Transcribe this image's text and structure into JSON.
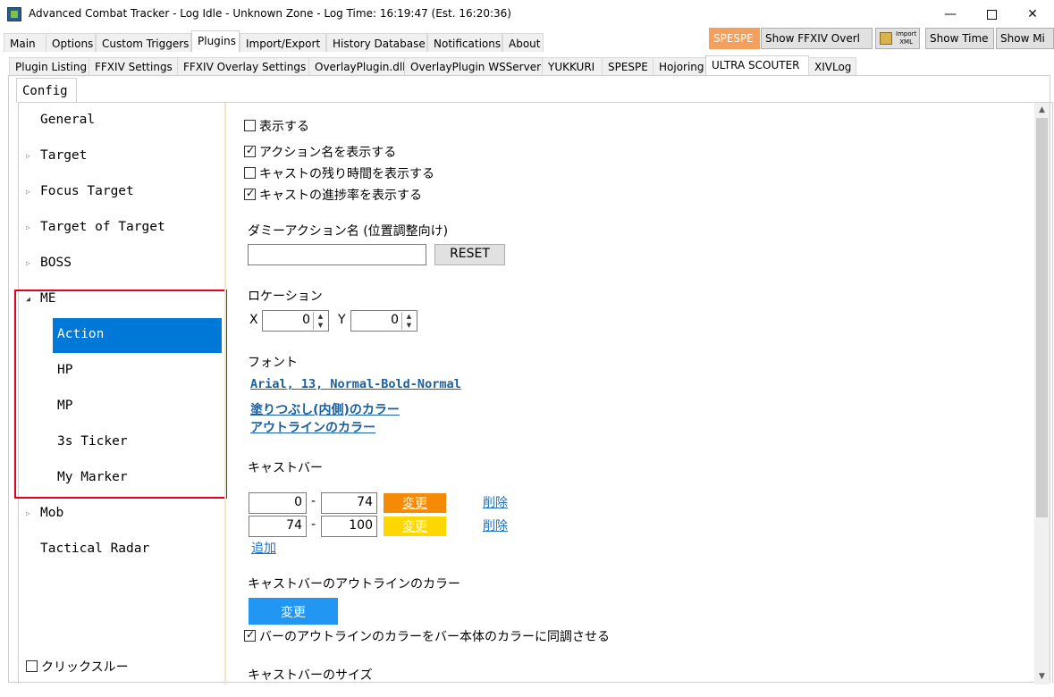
{
  "window": {
    "title": "Advanced Combat Tracker - Log Idle - Unknown Zone - Log Time: 16:19:47 (Est. 16:20:36)",
    "minimize_glyph": "—",
    "close_glyph": "✕"
  },
  "main_tabs": [
    "Main",
    "Options",
    "Custom Triggers",
    "Plugins",
    "Import/Export",
    "History Database",
    "Notifications",
    "About"
  ],
  "right_buttons": {
    "spespe": "SPESPE",
    "show_overlay": "Show FFXIV Overl",
    "import_xml": "Import XML",
    "import_line1": "Import",
    "import_line2": "XML",
    "show_time": "Show Time",
    "show_mi": "Show Mi"
  },
  "plugin_tabs": [
    "Plugin Listing",
    "FFXIV Settings",
    "FFXIV Overlay Settings",
    "OverlayPlugin.dll",
    "OverlayPlugin WSServer",
    "YUKKURI",
    "SPESPE",
    "Hojoring",
    "ULTRA SCOUTER",
    "XIVLog"
  ],
  "config_tab": "Config",
  "tree": {
    "items": [
      {
        "label": "General",
        "arrow": ""
      },
      {
        "label": "Target",
        "arrow": "▷"
      },
      {
        "label": "Focus Target",
        "arrow": "▷"
      },
      {
        "label": "Target of Target",
        "arrow": "▷"
      },
      {
        "label": "BOSS",
        "arrow": "▷"
      },
      {
        "label": "ME",
        "arrow": "◢"
      },
      {
        "label": "Action",
        "arrow": ""
      },
      {
        "label": "HP",
        "arrow": ""
      },
      {
        "label": "MP",
        "arrow": ""
      },
      {
        "label": "3s Ticker",
        "arrow": ""
      },
      {
        "label": "My Marker",
        "arrow": ""
      },
      {
        "label": "Mob",
        "arrow": "▷"
      },
      {
        "label": "Tactical Radar",
        "arrow": ""
      }
    ],
    "click_through": "クリックスルー"
  },
  "settings": {
    "show": "表示する",
    "show_action_name": "アクション名を表示する",
    "show_cast_remaining": "キャストの残り時間を表示する",
    "show_cast_progress": "キャストの進捗率を表示する",
    "dummy_action_label": "ダミーアクション名 (位置調整向け)",
    "dummy_action_value": "",
    "reset_button": "RESET",
    "location_label": "ロケーション",
    "x_label": "X",
    "x_value": "0",
    "y_label": "Y",
    "y_value": "0",
    "font_label": "フォント",
    "font_value": "Arial, 13, Normal-Bold-Normal",
    "fill_color_link": "塗りつぶし(内側)のカラー",
    "outline_color_link": "アウトラインのカラー",
    "castbar_label": "キャストバー",
    "castbar_rows": [
      {
        "from": "0",
        "to": "74",
        "change": "変更",
        "delete": "削除",
        "color": "#f58a07"
      },
      {
        "from": "74",
        "to": "100",
        "change": "変更",
        "delete": "削除",
        "color": "#ffd700"
      }
    ],
    "range_dash": "-",
    "add_link": "追加",
    "castbar_outline_label": "キャストバーのアウトラインのカラー",
    "outline_change_button": "変更",
    "outline_change_color": "#2196f3",
    "sync_outline_label": "バーのアウトラインのカラーをバー本体のカラーに同調させる",
    "castbar_size_label": "キャストバーのサイズ"
  }
}
